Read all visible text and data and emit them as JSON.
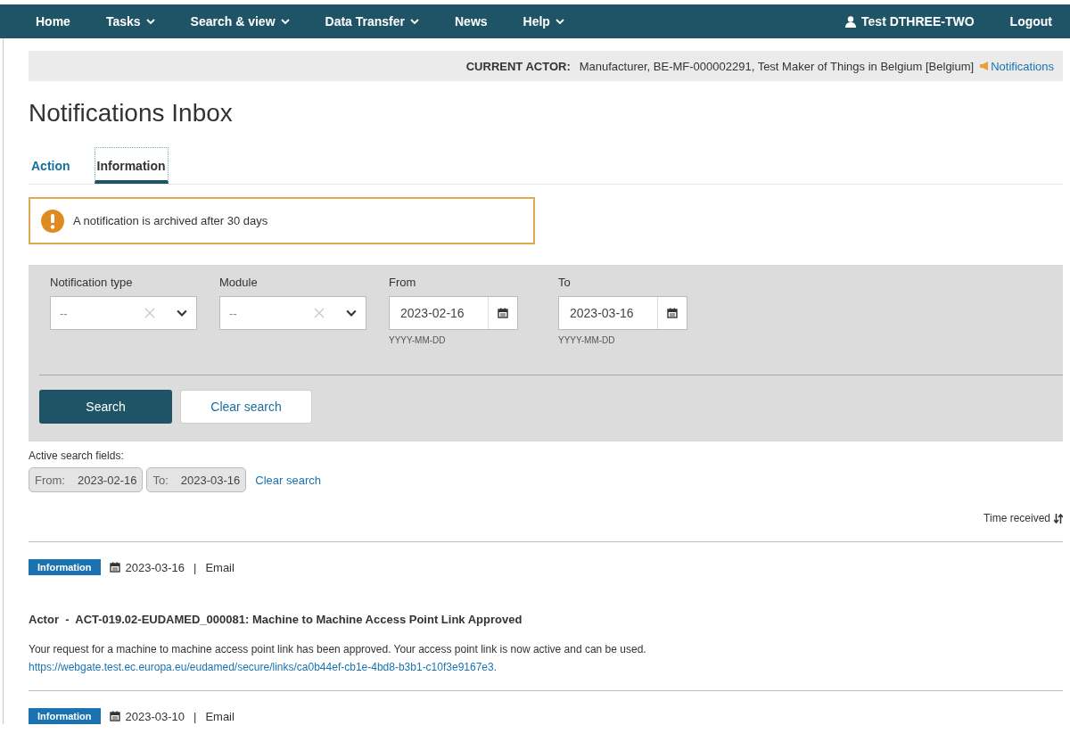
{
  "nav": {
    "items": [
      {
        "label": "Home",
        "dropdown": false
      },
      {
        "label": "Tasks",
        "dropdown": true
      },
      {
        "label": "Search & view",
        "dropdown": true
      },
      {
        "label": "Data Transfer",
        "dropdown": true
      },
      {
        "label": "News",
        "dropdown": false
      },
      {
        "label": "Help",
        "dropdown": true
      }
    ],
    "user": "Test DTHREE-TWO",
    "logout": "Logout"
  },
  "actor_bar": {
    "label": "CURRENT ACTOR:",
    "value": "Manufacturer, BE-MF-000002291, Test Maker of Things in Belgium [Belgium]",
    "link": "Notifications"
  },
  "title": "Notifications Inbox",
  "tabs": [
    {
      "label": "Action",
      "selected": false
    },
    {
      "label": "Information",
      "selected": true
    }
  ],
  "alert": {
    "text": "A notification is archived after 30 days"
  },
  "filters": [
    {
      "kind": "select",
      "label": "Notification type",
      "placeholder": "--"
    },
    {
      "kind": "select",
      "label": "Module",
      "placeholder": "--"
    },
    {
      "kind": "date",
      "label": "From",
      "value": "2023-02-16",
      "hint": "YYYY-MM-DD"
    },
    {
      "kind": "date",
      "label": "To",
      "value": "2023-03-16",
      "hint": "YYYY-MM-DD"
    }
  ],
  "buttons": {
    "search": "Search",
    "clear": "Clear search"
  },
  "active_search": {
    "label": "Active search fields:",
    "chips": [
      {
        "name": "From:",
        "value": "2023-02-16"
      },
      {
        "name": "To:",
        "value": "2023-03-16"
      }
    ],
    "clear": "Clear search"
  },
  "sort": {
    "label": "Time received"
  },
  "notifications": [
    {
      "badge": "Information",
      "date": "2023-03-16",
      "separator": "|",
      "channel": "Email",
      "title": "Actor  -  ACT-019.02-EUDAMED_000081: Machine to Machine Access Point Link Approved",
      "body": "Your request for a machine to machine access point link has been approved. Your access point link is now active and can be used.",
      "link": "https://webgate.test.ec.europa.eu/eudamed/secure/links/ca0b44ef-cb1e-4bd8-b3b1-c10f3e9167e3."
    },
    {
      "badge": "Information",
      "date": "2023-03-10",
      "separator": "|",
      "channel": "Email"
    }
  ]
}
